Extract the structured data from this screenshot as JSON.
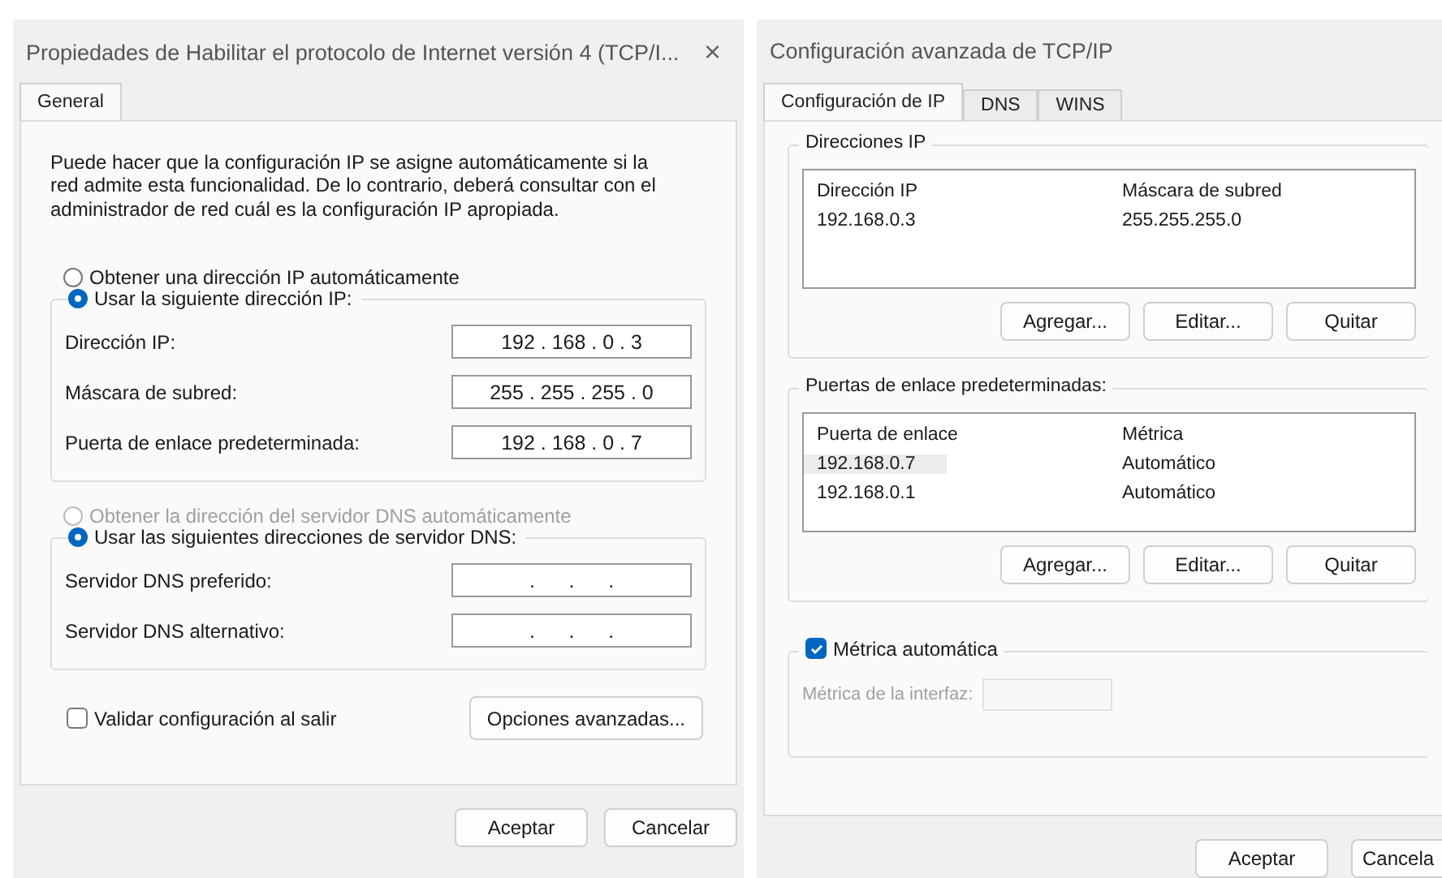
{
  "left_window": {
    "title": "Propiedades de Habilitar el protocolo de Internet versión 4 (TCP/I...",
    "close": "×",
    "tabs": [
      {
        "label": "General",
        "selected": true
      }
    ],
    "description": "Puede hacer que la configuración IP se asigne automáticamente si la red admite esta funcionalidad. De lo contrario, deberá consultar con el administrador de red cuál es la configuración IP apropiada.",
    "ip_options": [
      {
        "label": "Obtener una dirección IP automáticamente",
        "selected": false,
        "disabled": false
      },
      {
        "label": "Usar la siguiente dirección IP:",
        "selected": true,
        "disabled": false
      }
    ],
    "ip_fields": [
      {
        "label": "Dirección IP:",
        "value": "192 . 168 . 0 . 3"
      },
      {
        "label": "Máscara de subred:",
        "value": "255 . 255 . 255 . 0"
      },
      {
        "label": "Puerta de enlace predeterminada:",
        "value": "192 . 168 . 0 . 7"
      }
    ],
    "dns_options": [
      {
        "label": "Obtener la dirección del servidor DNS automáticamente",
        "selected": false,
        "disabled": true
      },
      {
        "label": "Usar las siguientes direcciones de servidor DNS:",
        "selected": true,
        "disabled": false
      }
    ],
    "dns_fields": [
      {
        "label": "Servidor DNS preferido:",
        "value": ".      .      ."
      },
      {
        "label": "Servidor DNS alternativo:",
        "value": ".      .      ."
      }
    ],
    "validate": {
      "label": "Validar configuración al salir",
      "checked": false
    },
    "advanced_button": "Opciones avanzadas...",
    "buttons": [
      "Aceptar",
      "Cancelar"
    ]
  },
  "right_window": {
    "title": "Configuración avanzada de TCP/IP",
    "tabs": [
      {
        "label": "Configuración de IP",
        "selected": true
      },
      {
        "label": "DNS",
        "selected": false
      },
      {
        "label": "WINS",
        "selected": false
      }
    ],
    "ip_addresses": {
      "title": "Direcciones IP",
      "columns": [
        "Dirección IP",
        "Máscara de subred"
      ],
      "rows": [
        {
          "cells": [
            "192.168.0.3",
            "255.255.255.0"
          ],
          "selected": false
        }
      ],
      "buttons": [
        "Agregar...",
        "Editar...",
        "Quitar"
      ]
    },
    "gateways": {
      "title": "Puertas de enlace predeterminadas:",
      "columns": [
        "Puerta de enlace",
        "Métrica"
      ],
      "rows": [
        {
          "cells": [
            "192.168.0.7",
            "Automático"
          ],
          "selected": true
        },
        {
          "cells": [
            "192.168.0.1",
            "Automático"
          ],
          "selected": false
        }
      ],
      "buttons": [
        "Agregar...",
        "Editar...",
        "Quitar"
      ]
    },
    "auto_metric": {
      "label": "Métrica automática",
      "checked": true
    },
    "interface_metric": {
      "label": "Métrica de la interfaz:",
      "disabled": true
    },
    "buttons": [
      "Aceptar",
      "Cancela"
    ]
  }
}
